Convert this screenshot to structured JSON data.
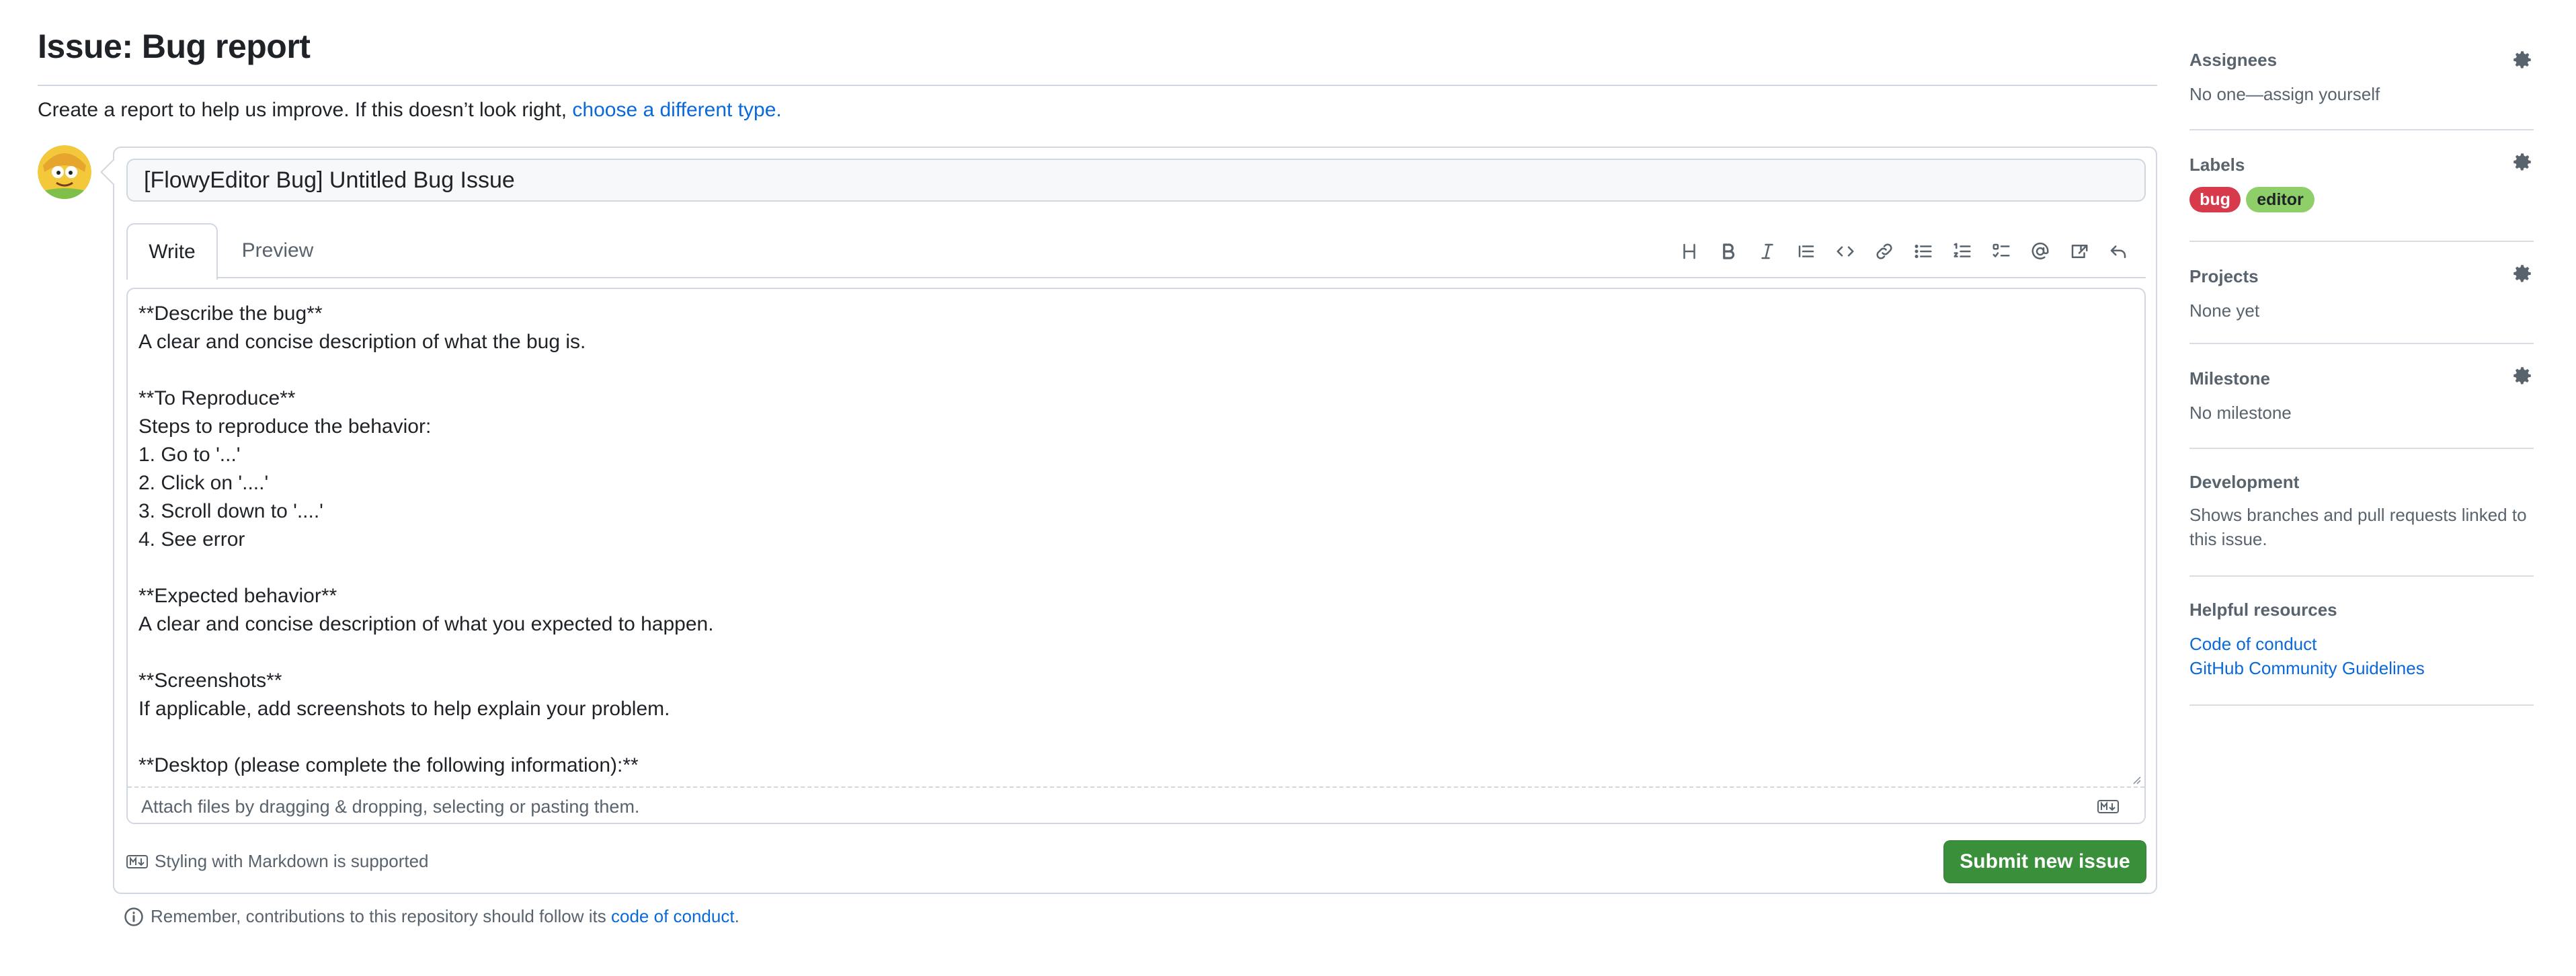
{
  "page": {
    "title": "Issue: Bug report"
  },
  "intro": {
    "text": "Create a report to help us improve. If this doesn’t look right,",
    "link": "choose a different type."
  },
  "form": {
    "title_value": "[FlowyEditor Bug] Untitled Bug Issue",
    "tabs": {
      "write": "Write",
      "preview": "Preview"
    },
    "toolbar": [
      {
        "icon": "heading-icon"
      },
      {
        "icon": "bold-icon"
      },
      {
        "icon": "italic-icon"
      },
      {
        "icon": "quote-icon"
      },
      {
        "icon": "code-icon"
      },
      {
        "icon": "link-icon"
      },
      {
        "icon": "unordered-list-icon"
      },
      {
        "icon": "ordered-list-icon"
      },
      {
        "icon": "task-list-icon"
      },
      {
        "icon": "mention-icon"
      },
      {
        "icon": "cross-reference-icon"
      },
      {
        "icon": "reply-icon"
      }
    ],
    "body": "**Describe the bug**\nA clear and concise description of what the bug is.\n\n**To Reproduce**\nSteps to reproduce the behavior:\n1. Go to '...'\n2. Click on '....'\n3. Scroll down to '....'\n4. See error\n\n**Expected behavior**\nA clear and concise description of what you expected to happen.\n\n**Screenshots**\nIf applicable, add screenshots to help explain your problem.\n\n**Desktop (please complete the following information):**",
    "attach_text": "Attach files by dragging & dropping, selecting or pasting them.",
    "markdown_hint": "Styling with Markdown is supported",
    "submit_label": "Submit new issue"
  },
  "footer": {
    "remember_text": "Remember, contributions to this repository should follow its",
    "remember_link": "code of conduct",
    "remember_end": "."
  },
  "sidebar": {
    "assignees": {
      "title": "Assignees",
      "value": "No one—assign yourself"
    },
    "labels": {
      "title": "Labels",
      "items": [
        {
          "name": "bug",
          "color": "#d73a4a",
          "text_color": "#ffffff"
        },
        {
          "name": "editor",
          "color": "#8fcf6a",
          "text_color": "#1f2328"
        }
      ]
    },
    "projects": {
      "title": "Projects",
      "value": "None yet"
    },
    "milestone": {
      "title": "Milestone",
      "value": "No milestone"
    },
    "development": {
      "title": "Development",
      "value": "Shows branches and pull requests linked to this issue."
    },
    "resources": {
      "title": "Helpful resources",
      "links": [
        "Code of conduct",
        "GitHub Community Guidelines"
      ]
    }
  },
  "colors": {
    "accent": "#0969da",
    "submit": "#3a8f3a",
    "border": "#d0d7de",
    "muted": "#59636e"
  }
}
